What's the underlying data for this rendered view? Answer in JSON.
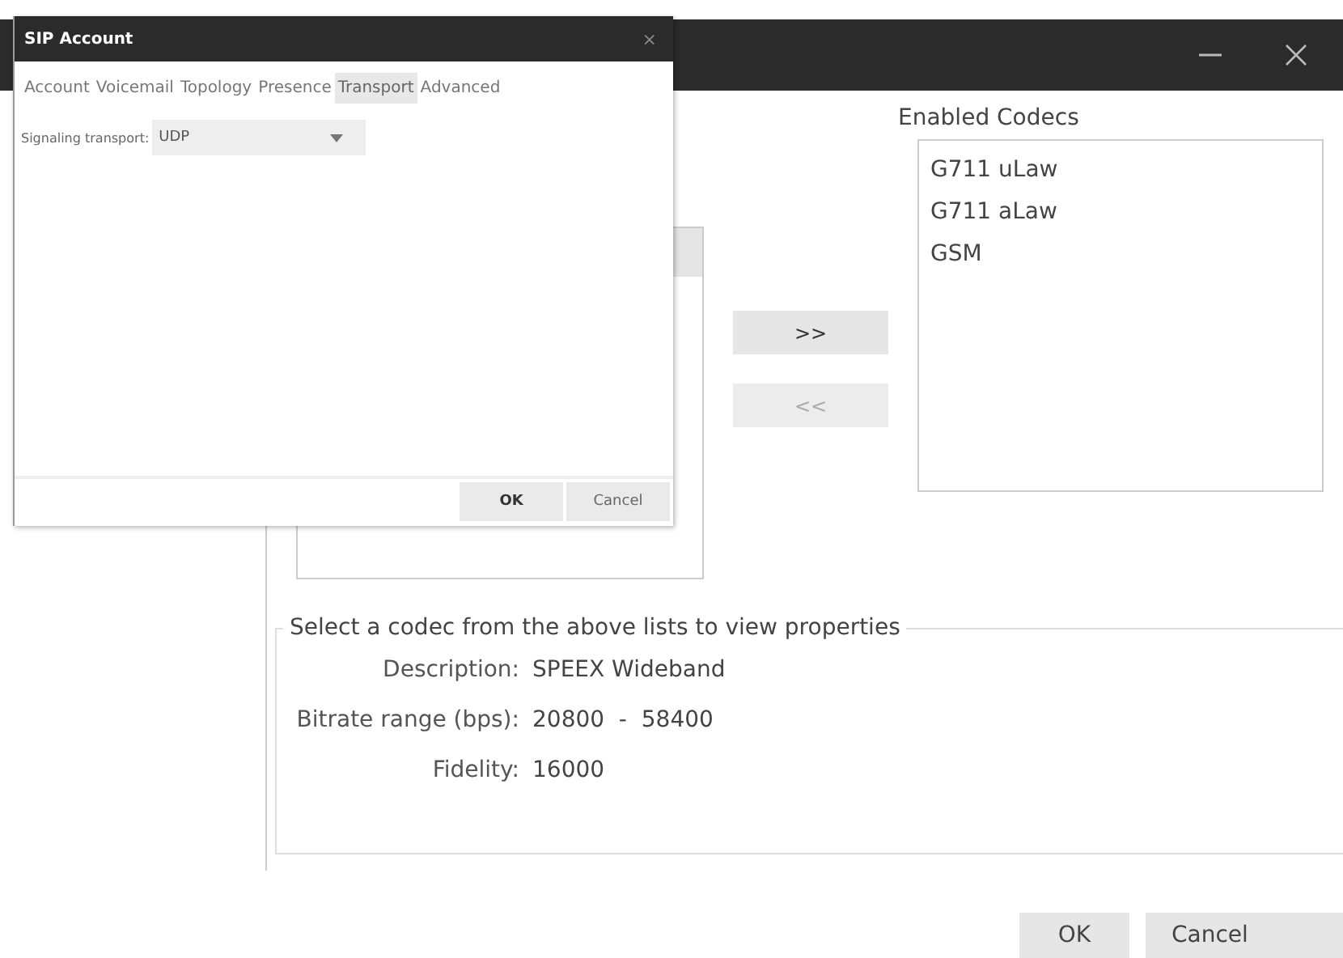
{
  "main_window": {
    "enabled_codecs": {
      "label": "Enabled Codecs",
      "items": [
        "G711 uLaw",
        "G711 aLaw",
        "GSM"
      ]
    },
    "move_buttons": [
      {
        "label": ">>",
        "disabled": false
      },
      {
        "label": "<<",
        "disabled": true
      }
    ],
    "properties": {
      "title": "Select a codec from the above lists to view properties",
      "fields": [
        {
          "label": "Description:",
          "value": "SPEEX Wideband"
        },
        {
          "label": "Bitrate range (bps):",
          "value": "20800  -  58400"
        },
        {
          "label": "Fidelity:",
          "value": "16000"
        }
      ]
    },
    "buttons": [
      "OK",
      "Cancel"
    ]
  },
  "dialog": {
    "title": "SIP Account",
    "close": "×",
    "tabs": [
      {
        "label": "Account",
        "selected": false
      },
      {
        "label": "Voicemail",
        "selected": false
      },
      {
        "label": "Topology",
        "selected": false
      },
      {
        "label": "Presence",
        "selected": false
      },
      {
        "label": "Transport",
        "selected": true
      },
      {
        "label": "Advanced",
        "selected": false
      }
    ],
    "signaling_transport": {
      "label": "Signaling transport:",
      "value": "UDP"
    },
    "buttons": [
      {
        "label": "OK",
        "default": true
      },
      {
        "label": "Cancel",
        "default": false
      }
    ]
  }
}
